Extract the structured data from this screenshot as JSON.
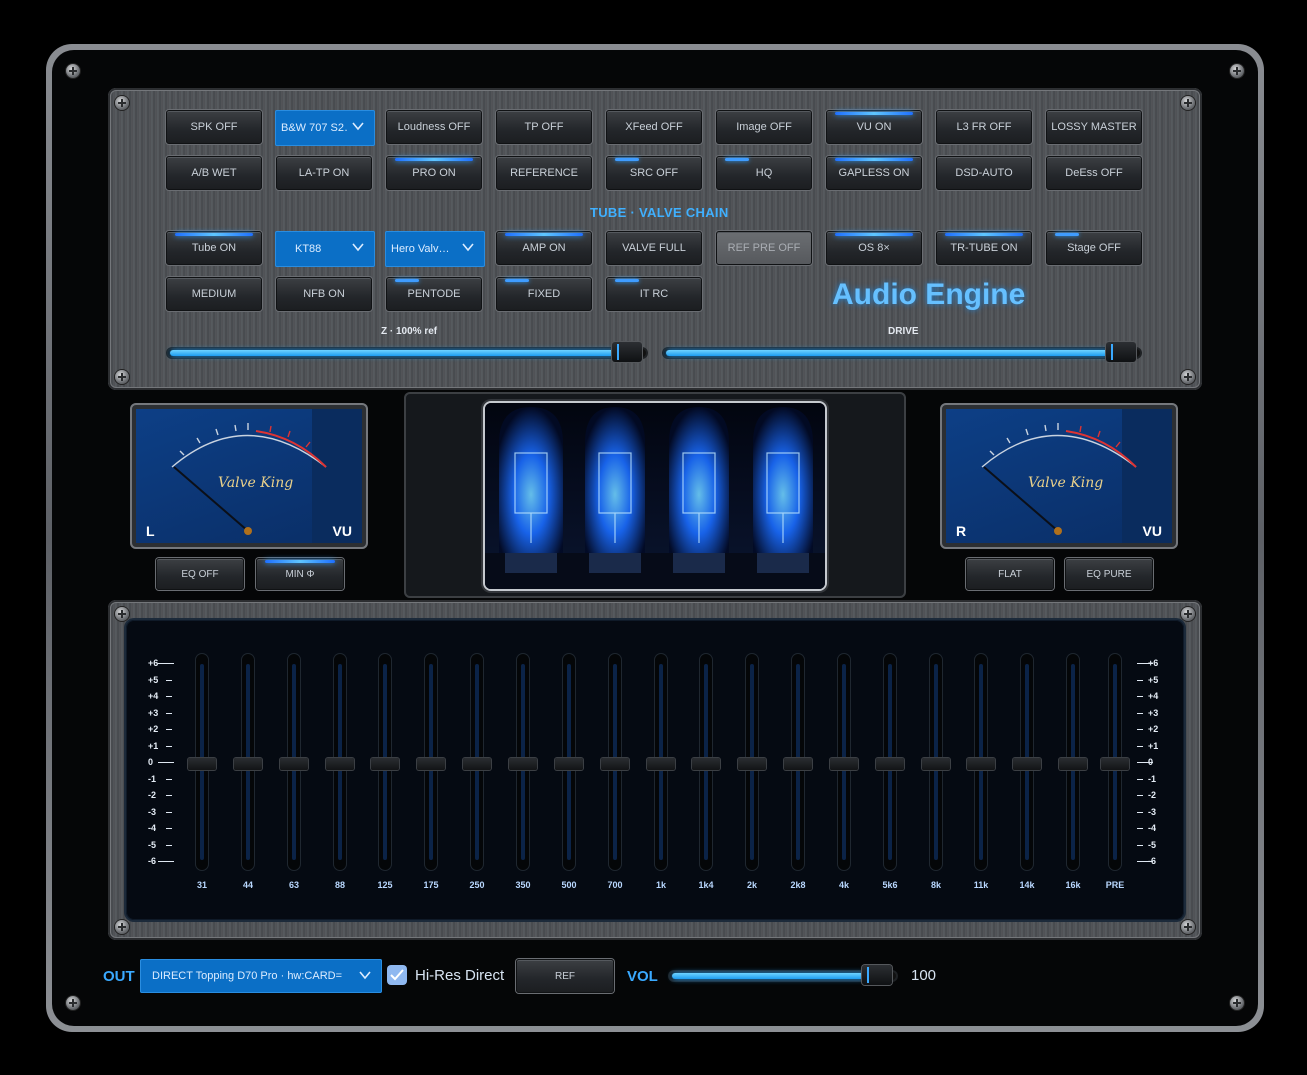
{
  "brand_title": "Audio Engine",
  "accent_color": "#2a9cff",
  "row1": [
    "SPK OFF",
    "B&W 707 S2…",
    "Loudness OFF",
    "TP OFF",
    "XFeed OFF",
    "Image OFF",
    "VU ON",
    "L3 FR OFF",
    "LOSSY MASTER"
  ],
  "row2": [
    "A/B WET",
    "LA-TP ON",
    "PRO ON",
    "REFERENCE",
    "SRC OFF",
    "HQ",
    "GAPLESS ON",
    "DSD-AUTO",
    "DeEss OFF"
  ],
  "tube_section_title": "TUBE · VALVE CHAIN",
  "row3": [
    "Tube ON",
    "KT88",
    "Hero Valv…",
    "AMP ON",
    "VALVE FULL",
    "REF PRE OFF",
    "OS 8×",
    "TR-TUBE ON",
    "Stage OFF"
  ],
  "row4": [
    "MEDIUM",
    "NFB ON",
    "PENTODE",
    "FIXED",
    "IT RC"
  ],
  "slider_z": {
    "label": "Z · 100% ref",
    "value": 1.0
  },
  "slider_drive": {
    "label": "DRIVE",
    "value": 1.0
  },
  "vu_left": {
    "channel": "L",
    "unit": "VU",
    "brand": "Valve King"
  },
  "vu_right": {
    "channel": "R",
    "unit": "VU",
    "brand": "Valve King"
  },
  "vu_left_buttons": [
    "EQ OFF",
    "MIN Φ"
  ],
  "vu_right_buttons": [
    "FLAT",
    "EQ PURE"
  ],
  "eq": {
    "scale": [
      "+6",
      "+5",
      "+4",
      "+3",
      "+2",
      "+1",
      "0",
      "-1",
      "-2",
      "-3",
      "-4",
      "-5",
      "-6"
    ],
    "bands": [
      "31",
      "44",
      "63",
      "88",
      "125",
      "175",
      "250",
      "350",
      "500",
      "700",
      "1k",
      "1k4",
      "2k",
      "2k8",
      "4k",
      "5k6",
      "8k",
      "11k",
      "14k",
      "16k",
      "PRE"
    ],
    "gains_db": [
      0,
      0,
      0,
      0,
      0,
      0,
      0,
      0,
      0,
      0,
      0,
      0,
      0,
      0,
      0,
      0,
      0,
      0,
      0,
      0,
      0
    ]
  },
  "bottom": {
    "out_label": "OUT",
    "out_device": "DIRECT  Topping D70 Pro · hw:CARD=",
    "hires_label": "Hi-Res Direct",
    "hires_checked": true,
    "ref_label": "REF",
    "vol_label": "VOL",
    "vol_value": "100",
    "vol_level": 1.0
  }
}
